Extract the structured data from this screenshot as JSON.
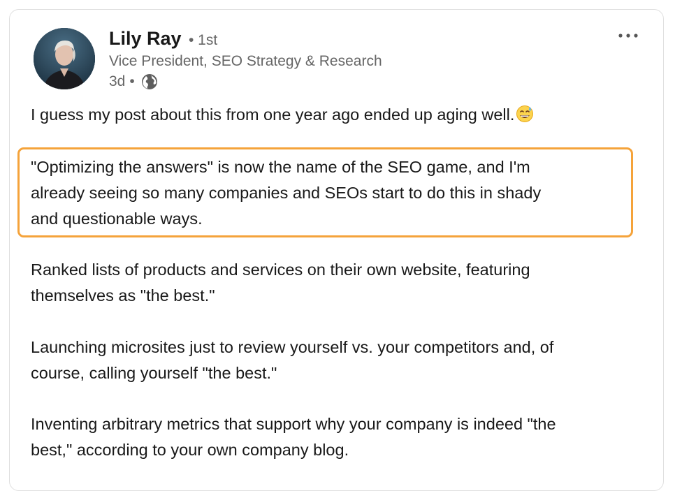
{
  "post": {
    "author": {
      "name": "Lily Ray",
      "degree": "• 1st",
      "headline": "Vice President, SEO Strategy & Research",
      "time": "3d",
      "time_separator": "•",
      "visibility_icon": "globe-icon"
    },
    "menu_icon": "more-horizontal-icon",
    "paragraphs": [
      "I guess my post about this from one year ago ended up aging well.",
      "\"Optimizing the answers\" is now the name of the SEO game, and I'm\nalready seeing so many companies and SEOs start to do this in shady\nand questionable ways.",
      "Ranked lists of products and services on their own website, featuring\nthemselves as \"the best.\"",
      "Launching microsites just to review yourself vs. your competitors and, of\ncourse, calling yourself \"the best.\"",
      "Inventing arbitrary metrics that support why your company is indeed \"the\nbest,\" according to your own company blog."
    ],
    "emoji_after_first_paragraph": "grinning-face-with-sweat-emoji",
    "highlight_color": "#f5a33a"
  }
}
